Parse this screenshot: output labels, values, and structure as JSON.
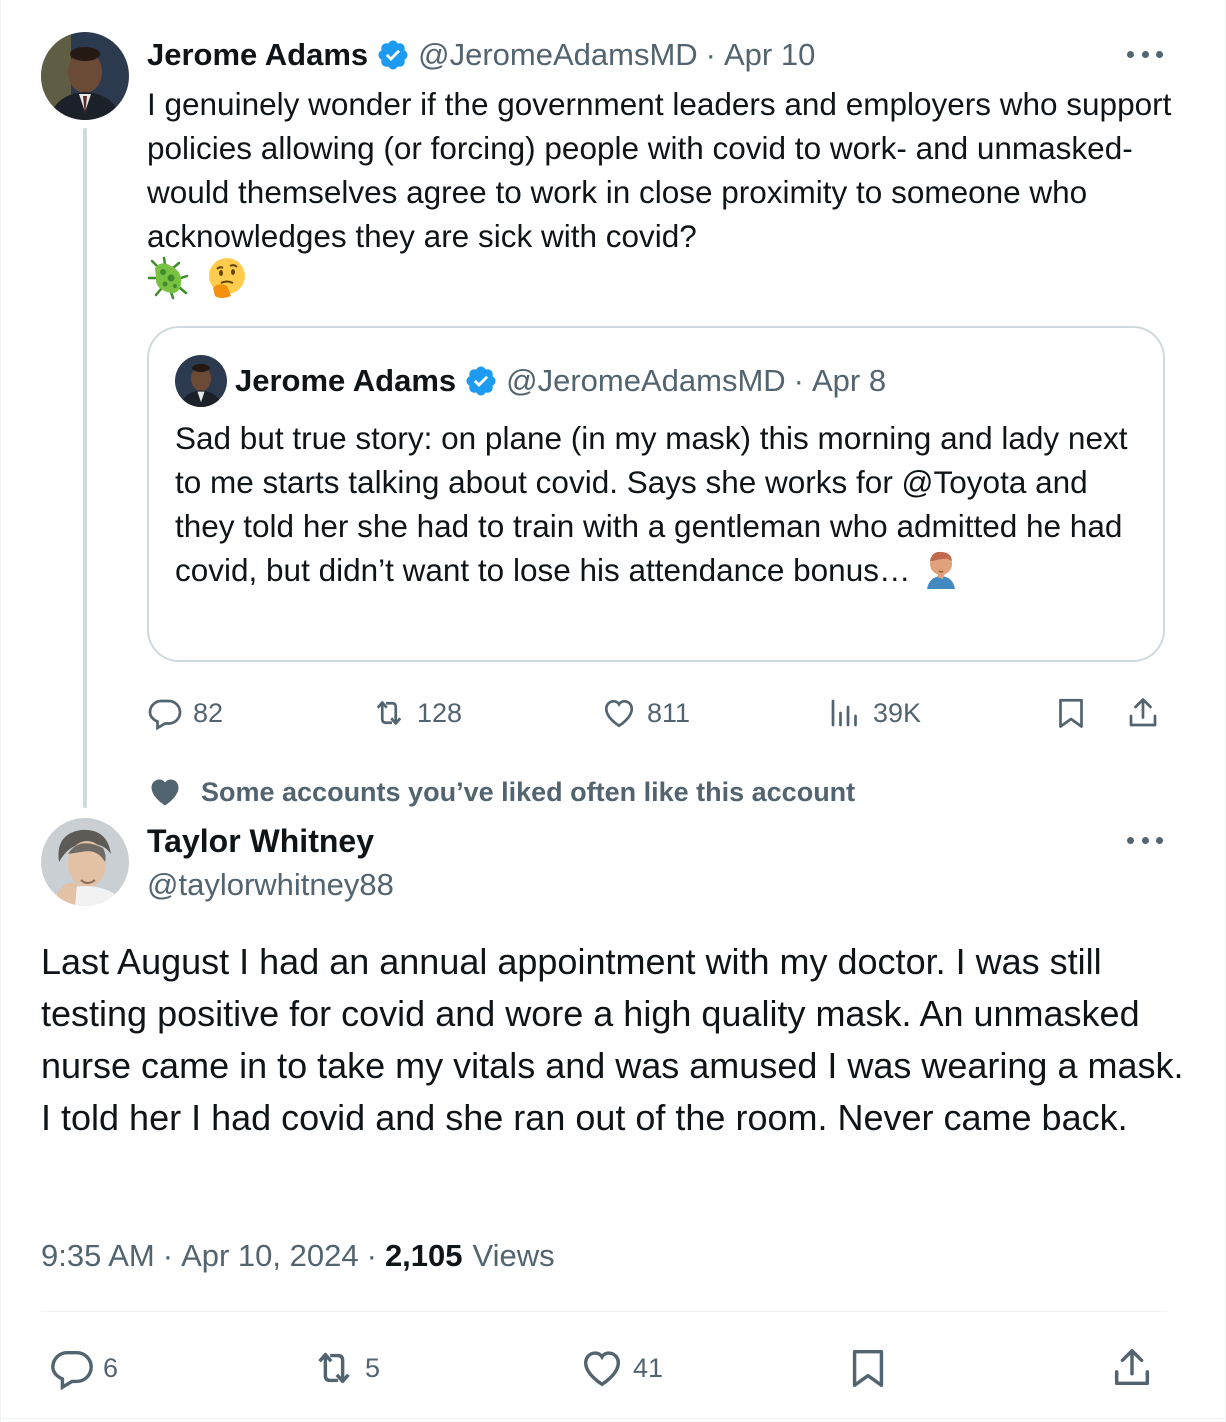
{
  "parent_tweet": {
    "author_name": "Jerome Adams",
    "handle": "@JeromeAdamsMD",
    "separator": "·",
    "date": "Apr 10",
    "text": "I genuinely wonder if the government leaders and employers who support policies allowing (or forcing) people with covid to work- and unmasked- would themselves agree to work in close proximity to someone who acknowledges they are sick with covid?",
    "emojis": [
      "microbe",
      "thinking-face"
    ],
    "quote": {
      "author_name": "Jerome Adams",
      "handle": "@JeromeAdamsMD",
      "separator": "·",
      "date": "Apr 8",
      "text": "Sad but true story: on plane (in my mask) this morning and lady next to me starts talking about covid. Says she works for @Toyota and they told her she had to train with a gentleman who admitted he had covid, but didn’t want to lose his attendance bonus…",
      "emoji": "man-facepalming"
    },
    "actions": {
      "replies": "82",
      "reposts": "128",
      "likes": "811",
      "views": "39K"
    }
  },
  "social_context": {
    "icon": "heart-icon",
    "text": "Some accounts you’ve liked often like this account"
  },
  "reply_tweet": {
    "author_name": "Taylor Whitney",
    "handle": "@taylorwhitney88",
    "text": "Last August I had an annual appointment with my doctor. I was still testing positive for covid and wore a high quality mask. An unmasked nurse came in to take my vitals and was amused I was wearing a mask. I told her I had covid and she ran out of the room. Never came back.",
    "time": "9:35 AM",
    "separator": "·",
    "date": "Apr 10, 2024",
    "views_count": "2,105",
    "views_label": "Views",
    "actions": {
      "replies": "6",
      "reposts": "5",
      "likes": "41"
    }
  },
  "colors": {
    "text_primary": "#0f1419",
    "text_secondary": "#536471",
    "verified_blue": "#1d9bf0",
    "border": "#cfd9de"
  }
}
